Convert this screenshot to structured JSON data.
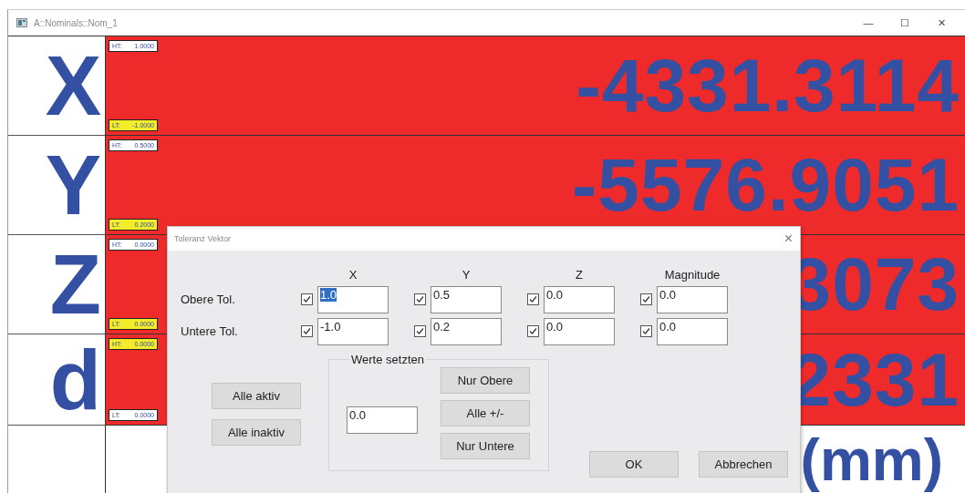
{
  "window": {
    "title": "A::Nominals::Nom_1",
    "controls": [
      "—",
      "☐",
      "✕"
    ]
  },
  "rows": [
    {
      "label": "X",
      "value": "-4331.3114",
      "ht": {
        "label": "HT:",
        "value": "1.0000",
        "highlighted": false
      },
      "lt": {
        "label": "LT:",
        "value": "-1.0000",
        "highlighted": true
      }
    },
    {
      "label": "Y",
      "value": "-5576.9051",
      "ht": {
        "label": "HT:",
        "value": "0.5000",
        "highlighted": false
      },
      "lt": {
        "label": "LT:",
        "value": "0.2000",
        "highlighted": true
      }
    },
    {
      "label": "Z",
      "value": "3073",
      "ht": {
        "label": "HT:",
        "value": "0.0000",
        "highlighted": false
      },
      "lt": {
        "label": "LT:",
        "value": "0.0000",
        "highlighted": true
      }
    },
    {
      "label": "d",
      "value": "2331",
      "ht": {
        "label": "HT:",
        "value": "0.0000",
        "highlighted": true
      },
      "lt": {
        "label": "LT:",
        "value": "0.0000",
        "highlighted": false
      }
    }
  ],
  "unit": "(mm)",
  "dialog": {
    "title": "Toleranz Vektor",
    "close": "×",
    "columns": [
      "X",
      "Y",
      "Z",
      "Magnitude"
    ],
    "tolerances": [
      {
        "label": "Obere Tol.",
        "fields": [
          {
            "checked": true,
            "value": "1.0",
            "selected": true
          },
          {
            "checked": true,
            "value": "0.5",
            "selected": false
          },
          {
            "checked": true,
            "value": "0.0",
            "selected": false
          },
          {
            "checked": true,
            "value": "0.0",
            "selected": false
          }
        ]
      },
      {
        "label": "Untere Tol.",
        "fields": [
          {
            "checked": true,
            "value": "-1.0",
            "selected": false
          },
          {
            "checked": true,
            "value": "0.2",
            "selected": false
          },
          {
            "checked": true,
            "value": "0.0",
            "selected": false
          },
          {
            "checked": true,
            "value": "0.0",
            "selected": false
          }
        ]
      }
    ],
    "toggle_buttons": [
      "Alle aktiv",
      "Alle inaktiv"
    ],
    "set_values": {
      "title": "Werte setzten",
      "value": "0.0",
      "buttons": [
        "Nur Obere",
        "Alle +/-",
        "Nur Untere"
      ]
    },
    "buttons": [
      "OK",
      "Abbrechen"
    ]
  }
}
